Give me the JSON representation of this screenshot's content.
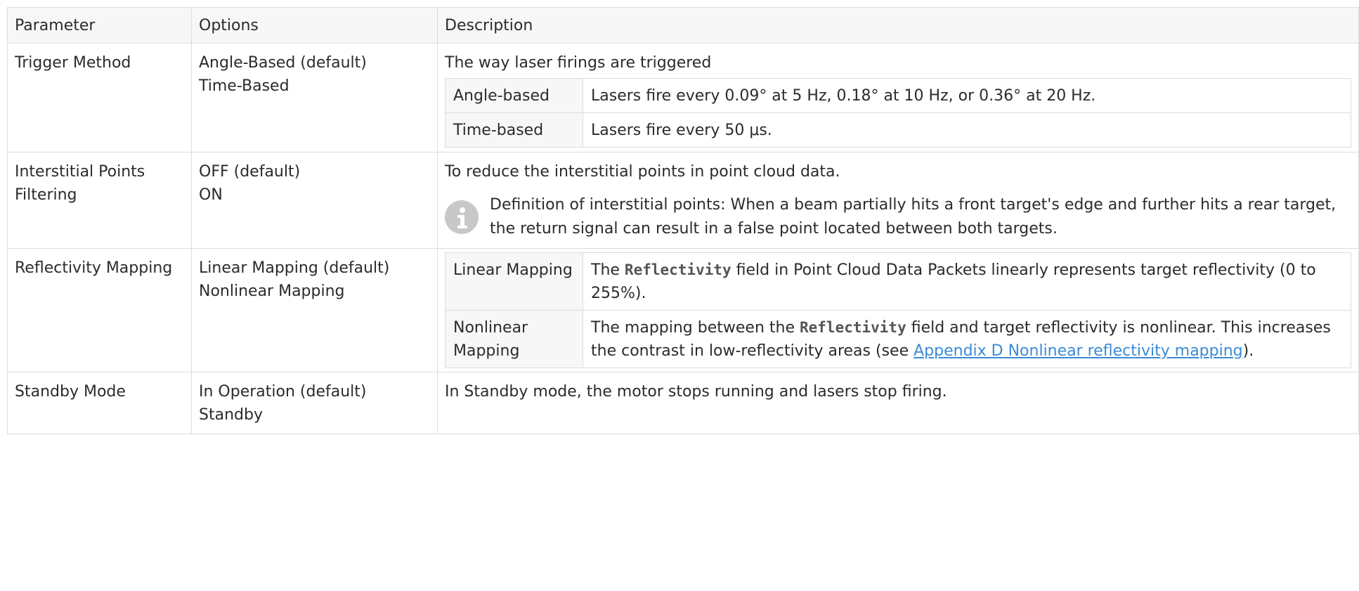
{
  "headers": {
    "parameter": "Parameter",
    "options": "Options",
    "description": "Description"
  },
  "rows": [
    {
      "parameter": "Trigger Method",
      "options": [
        "Angle-Based (default)",
        "Time-Based"
      ],
      "description": "The way laser firings are triggered",
      "sub_table": [
        {
          "key": "Angle-based",
          "value": "Lasers fire every 0.09° at 5 Hz, 0.18° at 10 Hz, or 0.36° at 20 Hz."
        },
        {
          "key": "Time-based",
          "value": "Lasers fire every 50 μs."
        }
      ]
    },
    {
      "parameter": "Interstitial Points Filtering",
      "options": [
        "OFF (default)",
        "ON"
      ],
      "description": "To reduce the interstitial points in point cloud data.",
      "note": "Definition of interstitial points: When a beam partially hits a front target's edge and further hits a rear target, the return signal can result in a false point located between both targets.",
      "note_icon": "info-icon"
    },
    {
      "parameter": "Reflectivity Mapping",
      "options": [
        "Linear Mapping (default)",
        "Nonlinear Mapping"
      ],
      "sub_table": [
        {
          "key": "Linear Mapping",
          "pre": "The ",
          "code": "Reflectivity",
          "post": " field in Point Cloud Data Packets linearly represents target reflectivity (0 to 255%)."
        },
        {
          "key": "Nonlinear Mapping",
          "pre": "The mapping between the ",
          "code": "Reflectivity",
          "post": " field and target reflectivity is nonlinear. This increases the contrast in low-reflectivity areas (see ",
          "link": "Appendix D Nonlinear reflectivity mapping",
          "tail": ")."
        }
      ]
    },
    {
      "parameter": "Standby Mode",
      "options": [
        "In Operation (default)",
        "Standby"
      ],
      "description": "In Standby mode, the motor stops running and lasers stop firing."
    }
  ],
  "colors": {
    "border": "#dcdcdc",
    "header_bg": "#f7f7f7",
    "link": "#3a8bd8",
    "icon": "#c8c8c8"
  }
}
